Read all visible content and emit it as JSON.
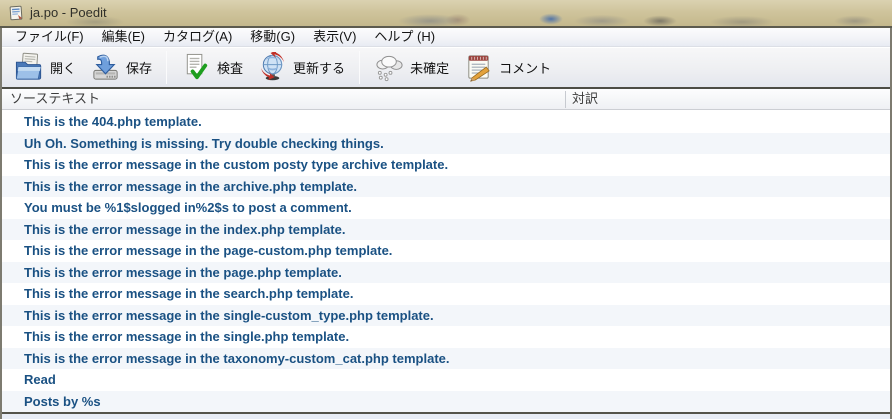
{
  "window": {
    "title": "ja.po - Poedit"
  },
  "menu_bar": {
    "items": [
      {
        "label": "ファイル(F)"
      },
      {
        "label": "編集(E)"
      },
      {
        "label": "カタログ(A)"
      },
      {
        "label": "移動(G)"
      },
      {
        "label": "表示(V)"
      },
      {
        "label": "ヘルプ (H)"
      }
    ]
  },
  "toolbar": {
    "buttons": [
      {
        "label": "開く",
        "icon": "open-icon"
      },
      {
        "label": "保存",
        "icon": "save-icon"
      },
      {
        "label": "検査",
        "icon": "validate-icon"
      },
      {
        "label": "更新する",
        "icon": "update-icon"
      },
      {
        "label": "未確定",
        "icon": "fuzzy-icon"
      },
      {
        "label": "コメント",
        "icon": "comment-icon"
      }
    ]
  },
  "list": {
    "columns": [
      {
        "label": "ソーステキスト"
      },
      {
        "label": "対訳"
      }
    ],
    "rows": [
      {
        "source": "This is the 404.php template.",
        "translation": ""
      },
      {
        "source": "Uh Oh. Something is missing. Try double checking things.",
        "translation": ""
      },
      {
        "source": "This is the error message in the custom posty type archive template.",
        "translation": ""
      },
      {
        "source": "This is the error message in the archive.php template.",
        "translation": ""
      },
      {
        "source": "You must be %1$slogged in%2$s to post a comment.",
        "translation": ""
      },
      {
        "source": "This is the error message in the index.php template.",
        "translation": ""
      },
      {
        "source": "This is the error message in the page-custom.php template.",
        "translation": ""
      },
      {
        "source": "This is the error message in the page.php template.",
        "translation": ""
      },
      {
        "source": "This is the error message in the search.php template.",
        "translation": ""
      },
      {
        "source": "This is the error message in the single-custom_type.php template.",
        "translation": ""
      },
      {
        "source": "This is the error message in the single.php template.",
        "translation": ""
      },
      {
        "source": "This is the error message in the taxonomy-custom_cat.php template.",
        "translation": ""
      },
      {
        "source": "Read",
        "translation": ""
      },
      {
        "source": "Posts by %s",
        "translation": ""
      }
    ]
  },
  "colors": {
    "titlebar_glass": "#cfc49c",
    "untranslated_text": "#1a5183",
    "row_stripe": "#f3f6fa",
    "header_text": "#3c3c3c"
  }
}
